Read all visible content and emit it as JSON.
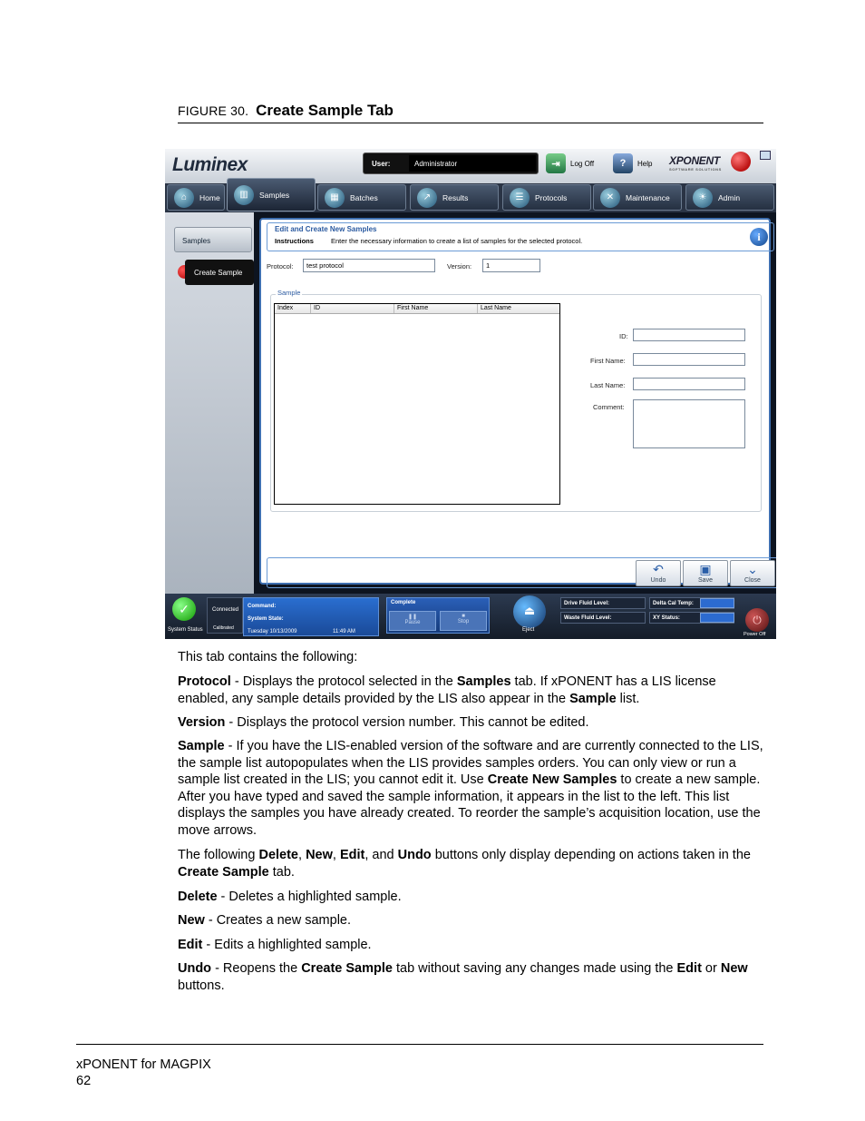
{
  "figure": {
    "number": "FIGURE 30.",
    "title": "Create Sample Tab"
  },
  "app": {
    "logo": "Luminex",
    "user_label": "User:",
    "user_value": "Administrator",
    "log_off": "Log Off",
    "help": "Help",
    "brand": "XPONENT",
    "brand_sub": "SOFTWARE SOLUTIONS",
    "tabs": [
      "Home",
      "Samples",
      "Batches",
      "Results",
      "Protocols",
      "Maintenance",
      "Admin"
    ],
    "side": {
      "samples": "Samples",
      "create_sample": "Create Sample"
    },
    "panel": {
      "heading": "Edit and Create New Samples",
      "instructions_label": "Instructions",
      "instructions_text": "Enter the necessary information to create a list of samples for the selected protocol.",
      "protocol_label": "Protocol:",
      "protocol_value": "test protocol",
      "version_label": "Version:",
      "version_value": "1",
      "group_label": "Sample",
      "columns": [
        "Index",
        "ID",
        "First Name",
        "Last Name"
      ],
      "id_label": "ID:",
      "first_name_label": "First Name:",
      "last_name_label": "Last Name:",
      "comment_label": "Comment:",
      "undo": "Undo",
      "save": "Save",
      "close": "Close"
    },
    "status": {
      "system_status": "System Status",
      "connected": "Connected",
      "calibrated": "Calibrated",
      "command": "Command:",
      "system_state": "System State:",
      "date": "Tuesday 10/13/2009",
      "time": "11:49 AM",
      "complete": "Complete",
      "pause": "Pause",
      "stop": "Stop",
      "eject": "Eject",
      "drive_fluid": "Drive Fluid Level:",
      "waste_fluid": "Waste Fluid Level:",
      "delta_cal": "Delta Cal Temp:",
      "xy_status": "XY Status:",
      "power_off": "Power Off"
    }
  },
  "text": {
    "intro": "This tab contains the following:",
    "p1_b1": "Protocol",
    "p1_t1": " - Displays the protocol selected in the ",
    "p1_b2": "Samples",
    "p1_t2": " tab. If xPONENT has a LIS license enabled, any sample details provided by the LIS also appear in the ",
    "p1_b3": "Sample",
    "p1_t3": " list.",
    "p2_b1": "Version",
    "p2_t1": " - Displays the protocol version number. This cannot be edited.",
    "p3_b1": "Sample",
    "p3_t1": " - If you have the LIS-enabled version of the software and are currently connected to the LIS, the sample list autopopulates when the LIS provides samples orders. You can only view or run a sample list created in the LIS; you cannot edit it. Use ",
    "p3_b2": "Create New Samples",
    "p3_t2": " to create a new sample. After you have typed and saved the sample information, it appears in the list to the left. This list displays the samples you have already created. To reorder the sample’s acquisition location, use the move arrows.",
    "p4_t0": "The following ",
    "p4_b1": "Delete",
    "p4_t1": ", ",
    "p4_b2": "New",
    "p4_t2": ", ",
    "p4_b3": "Edit",
    "p4_t3": ", and ",
    "p4_b4": "Undo",
    "p4_t4": " buttons only display depending on actions taken in the ",
    "p4_b5": "Create Sample",
    "p4_t5": " tab.",
    "p5_b1": "Delete",
    "p5_t1": " - Deletes a highlighted sample.",
    "p6_b1": "New",
    "p6_t1": " - Creates a new sample.",
    "p7_b1": "Edit",
    "p7_t1": " - Edits a highlighted sample.",
    "p8_b1": "Undo",
    "p8_t1": " - Reopens the ",
    "p8_b2": "Create Sample",
    "p8_t2": " tab without saving any changes made using the ",
    "p8_b3": "Edit",
    "p8_t3": " or ",
    "p8_b4": "New",
    "p8_t4": " buttons."
  },
  "footer": {
    "product": "xPONENT for MAGPIX",
    "page": "62"
  }
}
